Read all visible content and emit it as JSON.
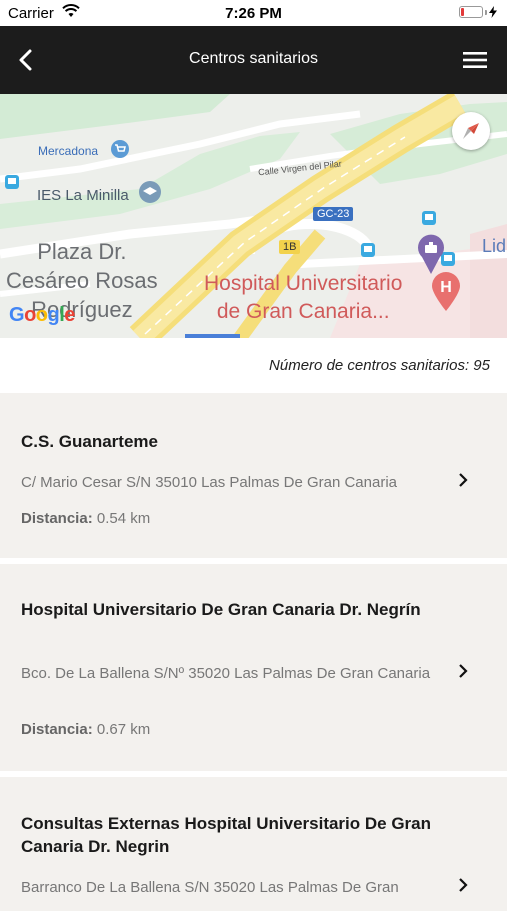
{
  "status_bar": {
    "carrier": "Carrier",
    "time": "7:26 PM",
    "battery_level": 0.15
  },
  "nav": {
    "title": "Centros sanitarios",
    "back_icon": "chevron-left-icon",
    "menu_icon": "hamburger-menu-icon"
  },
  "map": {
    "labels": {
      "mercadona": "Mercadona",
      "ies": "IES La Minilla",
      "street": "Calle Virgen del Pilar",
      "road": "GC-23",
      "exit": "1B",
      "plaza": "Plaza Dr.\nCesáreo Rosas\nRodríguez",
      "hospital": "Hospital Universitario\nde Gran Canaria...",
      "lidl": "Lid",
      "google": "Google"
    }
  },
  "count_text": "Número de centros sanitarios: 95",
  "distance_label": "Distancia:",
  "centers": [
    {
      "name": "C.S. Guanarteme",
      "address": "C/ Mario Cesar S/N 35010 Las Palmas De Gran Canaria",
      "distance": "0.54 km"
    },
    {
      "name": "Hospital Universitario De Gran Canaria Dr. Negrín",
      "address": "Bco. De La Ballena S/Nº 35020 Las Palmas De Gran Canaria",
      "distance": "0.67 km"
    },
    {
      "name": "Consultas Externas Hospital Universitario De Gran Canaria Dr. Negrin",
      "address": "Barranco De La Ballena S/N 35020 Las Palmas De Gran",
      "distance": ""
    }
  ]
}
